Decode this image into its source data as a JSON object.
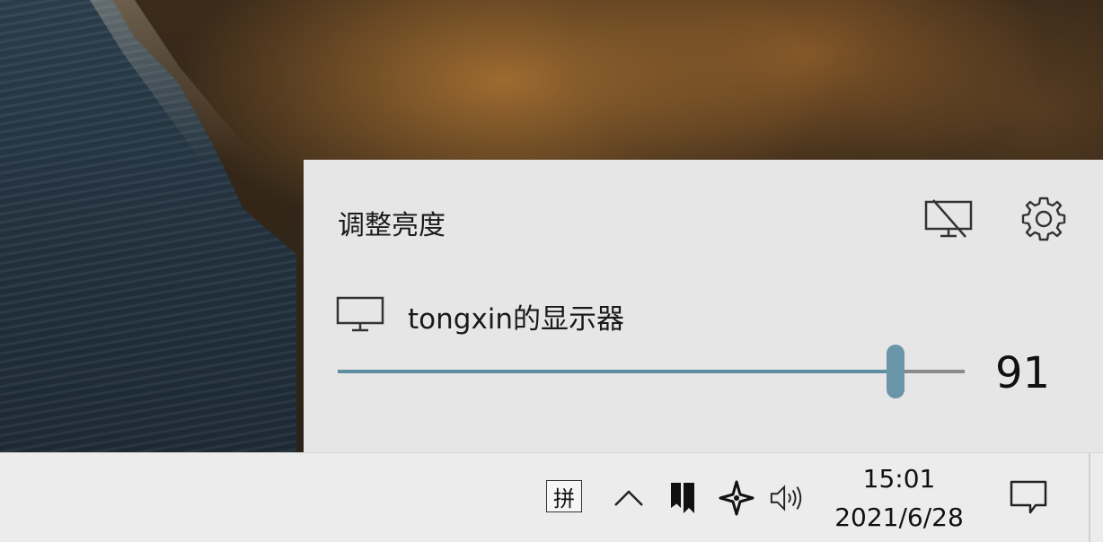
{
  "flyout": {
    "title": "调整亮度",
    "project_icon": "project-off-icon",
    "settings_icon": "gear-icon",
    "display": {
      "icon": "monitor-icon",
      "name": "tongxin的显示器"
    },
    "brightness": {
      "value": 91,
      "value_text": "91",
      "min": 0,
      "max": 100,
      "fill_fraction": 0.89
    },
    "accent_color": "#6a95a9"
  },
  "taskbar": {
    "ime_label": "拼",
    "tray_icons": [
      "chevron-up-icon",
      "app-bookmark-icon",
      "network-sparkle-icon",
      "volume-icon"
    ],
    "clock": {
      "time": "15:01",
      "date": "2021/6/28"
    },
    "notification_icon": "notification-icon"
  }
}
